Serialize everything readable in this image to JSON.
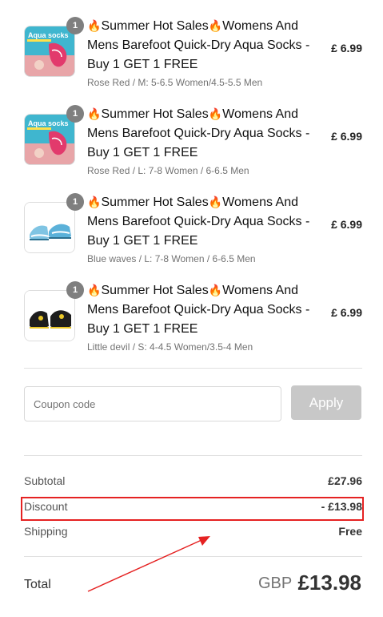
{
  "line_items": [
    {
      "quantity": "1",
      "title_prefix": "🔥",
      "title_mid": "Summer Hot Sales",
      "title_fire2": "🔥",
      "title_rest": "Womens And Mens Barefoot Quick-Dry Aqua Socks - Buy 1 GET 1 FREE",
      "variant": "Rose Red / M: 5-6.5 Women/4.5-5.5 Men",
      "price": "£ 6.99",
      "image": "aqua-socks-pink-image",
      "image_caption": "Aqua socks"
    },
    {
      "quantity": "1",
      "title_prefix": "🔥",
      "title_mid": "Summer Hot Sales",
      "title_fire2": "🔥",
      "title_rest": "Womens And Mens Barefoot Quick-Dry Aqua Socks - Buy 1 GET 1 FREE",
      "variant": "Rose Red / L: 7-8 Women / 6-6.5 Men",
      "price": "£ 6.99",
      "image": "aqua-socks-pink-image",
      "image_caption": "Aqua socks"
    },
    {
      "quantity": "1",
      "title_prefix": "🔥",
      "title_mid": "Summer Hot Sales",
      "title_fire2": "🔥",
      "title_rest": "Womens And Mens Barefoot Quick-Dry Aqua Socks - Buy 1 GET 1 FREE",
      "variant": "Blue waves / L: 7-8 Women / 6-6.5 Men",
      "price": "£ 6.99",
      "image": "blue-waves-shoes-image"
    },
    {
      "quantity": "1",
      "title_prefix": "🔥",
      "title_mid": "Summer Hot Sales",
      "title_fire2": "🔥",
      "title_rest": "Womens And Mens Barefoot Quick-Dry Aqua Socks - Buy 1 GET 1 FREE",
      "variant": "Little devil / S: 4-4.5 Women/3.5-4 Men",
      "price": "£ 6.99",
      "image": "black-devil-shoes-image"
    }
  ],
  "coupon": {
    "placeholder": "Coupon code",
    "apply_label": "Apply"
  },
  "summary": {
    "subtotal_label": "Subtotal",
    "subtotal_value": "£27.96",
    "discount_label": "Discount",
    "discount_value": "- £13.98",
    "shipping_label": "Shipping",
    "shipping_value": "Free"
  },
  "total": {
    "label": "Total",
    "currency": "GBP",
    "amount": "£13.98"
  },
  "colors": {
    "annotation_red": "#e52222",
    "apply_disabled": "#c8c8c8",
    "badge_gray": "#7f7f7f"
  }
}
